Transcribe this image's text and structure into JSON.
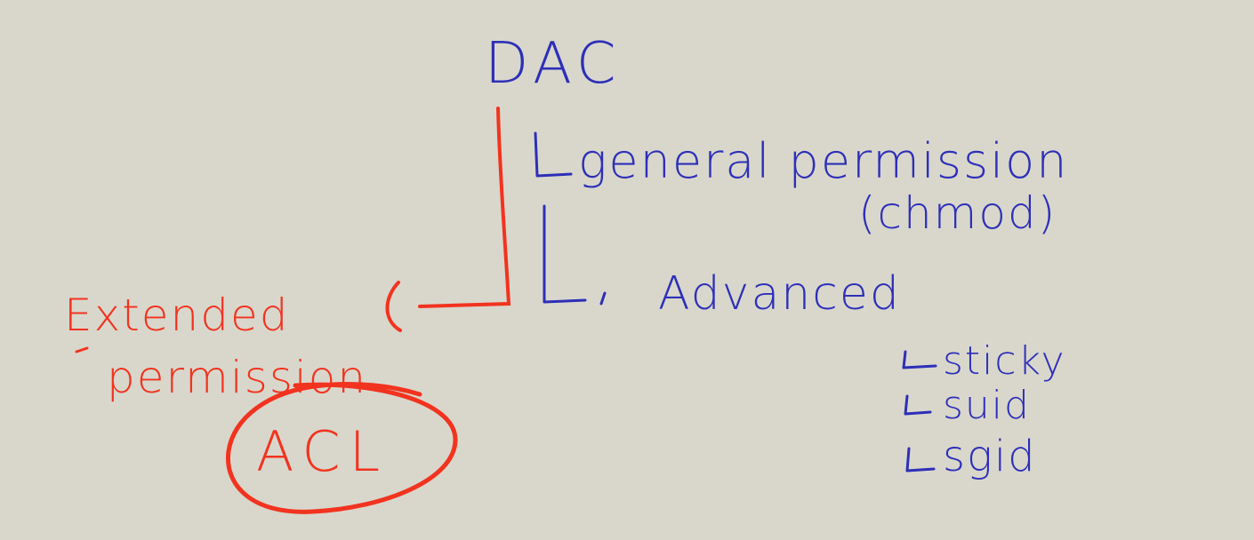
{
  "diagram": {
    "root": "DAC",
    "general_permission": "general permission",
    "chmod": "(chmod)",
    "advanced": "Advanced",
    "advanced_items": [
      "sticky",
      "suid",
      "sgid"
    ],
    "extended_line1": "Extended",
    "extended_line2": "permission",
    "acl": "ACL"
  },
  "colors": {
    "background": "#d9d7cc",
    "blue_ink": "#2d2fb8",
    "red_ink": "#f2331f"
  }
}
